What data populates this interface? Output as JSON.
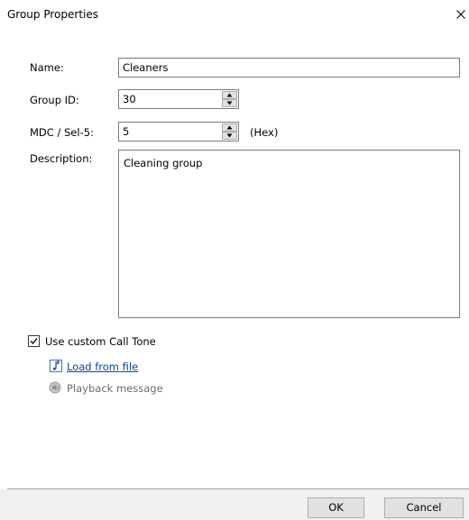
{
  "window": {
    "title": "Group Properties"
  },
  "form": {
    "name_label": "Name:",
    "name_value": "Cleaners",
    "group_id_label": "Group ID:",
    "group_id_value": "30",
    "mdc_label": "MDC / Sel-5:",
    "mdc_value": "5",
    "mdc_suffix": "(Hex)",
    "description_label": "Description:",
    "description_value": "Cleaning group"
  },
  "call_tone": {
    "checkbox_label": "Use custom Call Tone",
    "checked": true,
    "load_link": "Load from file",
    "playback_label": "Playback message",
    "load_icon": "music-note-icon",
    "playback_icon": "speaker-icon"
  },
  "buttons": {
    "ok": "OK",
    "cancel": "Cancel"
  },
  "colors": {
    "link": "#0645ad",
    "disabled_text": "#6d6d6d",
    "button_face": "#e1e1e1",
    "footer": "#f0f0f0"
  }
}
